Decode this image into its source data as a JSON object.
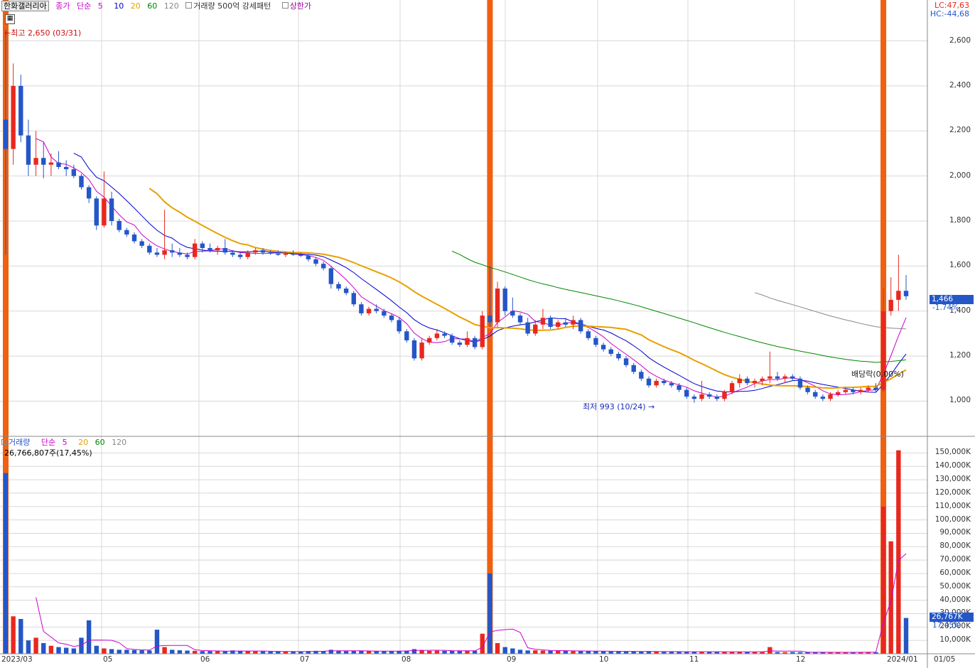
{
  "price_legend": {
    "stock_name": "한화갤러리아",
    "close_label": "종가",
    "ma_type": "단순",
    "ma_periods": [
      "5",
      "10",
      "20",
      "60",
      "120"
    ],
    "ma_colors": [
      "#cc00cc",
      "#0000cc",
      "#e8a000",
      "#008800",
      "#888888"
    ],
    "pattern_label": "거래량 500억 강세패턴",
    "limit_label": "상한가"
  },
  "volume_legend": {
    "title": "거래량",
    "ma_type": "단순",
    "ma_periods": [
      "5",
      "20",
      "60",
      "120"
    ],
    "summary": "26,766,807주(17,45%)"
  },
  "corner": {
    "lc": "LC:47,63",
    "hc": "HC:-44,68"
  },
  "annotations": {
    "high": "최고 2,650 (03/31)",
    "low": "최저 993 (10/24)",
    "ex_dividend": "배당락(0.00%)"
  },
  "current": {
    "price": "1,466",
    "change": "-1.74%",
    "volume": "26,767K",
    "volume_pct": "17.45%"
  },
  "price_axis": [
    "2,600",
    "2,400",
    "2,200",
    "2,000",
    "1,800",
    "1,600",
    "1,400",
    "1,200",
    "1,000"
  ],
  "volume_axis": [
    "150,000K",
    "140,000K",
    "130,000K",
    "120,000K",
    "110,000K",
    "100,000K",
    "90,000K",
    "80,000K",
    "70,000K",
    "60,000K",
    "50,000K",
    "40,000K",
    "30,000K",
    "20,000K",
    "10,000K"
  ],
  "x_labels": [
    "2023/03",
    "05",
    "06",
    "07",
    "08",
    "09",
    "10",
    "11",
    "12",
    "2024/01",
    "01/05"
  ],
  "colors": {
    "up": "#e8281e",
    "down": "#2456c8",
    "signal": "#f06010",
    "grid": "#d8d8d8"
  },
  "chart_data": {
    "type": "candlestick",
    "price_ylim": [
      850,
      2750
    ],
    "volume_ylim": [
      0,
      155000
    ],
    "candles": [
      [
        2250,
        2650,
        1650,
        2120
      ],
      [
        2120,
        2500,
        2050,
        2400
      ],
      [
        2400,
        2450,
        2150,
        2180
      ],
      [
        2180,
        2250,
        2000,
        2050
      ],
      [
        2050,
        2200,
        2000,
        2080
      ],
      [
        2080,
        2150,
        1990,
        2050
      ],
      [
        2050,
        2100,
        2000,
        2060
      ],
      [
        2060,
        2110,
        2030,
        2040
      ],
      [
        2040,
        2070,
        2000,
        2030
      ],
      [
        2030,
        2050,
        1990,
        2000
      ],
      [
        2000,
        2010,
        1940,
        1950
      ],
      [
        1950,
        1960,
        1880,
        1900
      ],
      [
        1900,
        1910,
        1760,
        1780
      ],
      [
        1780,
        2020,
        1770,
        1900
      ],
      [
        1900,
        1930,
        1780,
        1800
      ],
      [
        1800,
        1810,
        1750,
        1760
      ],
      [
        1760,
        1770,
        1730,
        1740
      ],
      [
        1740,
        1750,
        1700,
        1710
      ],
      [
        1710,
        1720,
        1680,
        1690
      ],
      [
        1690,
        1700,
        1650,
        1660
      ],
      [
        1660,
        1680,
        1640,
        1650
      ],
      [
        1650,
        1850,
        1630,
        1670
      ],
      [
        1670,
        1700,
        1640,
        1660
      ],
      [
        1660,
        1680,
        1640,
        1650
      ],
      [
        1650,
        1660,
        1630,
        1640
      ],
      [
        1640,
        1720,
        1630,
        1700
      ],
      [
        1700,
        1710,
        1660,
        1680
      ],
      [
        1680,
        1700,
        1660,
        1670
      ],
      [
        1670,
        1690,
        1650,
        1680
      ],
      [
        1680,
        1720,
        1650,
        1660
      ],
      [
        1660,
        1670,
        1640,
        1650
      ],
      [
        1650,
        1660,
        1630,
        1640
      ],
      [
        1640,
        1670,
        1630,
        1660
      ],
      [
        1660,
        1680,
        1650,
        1670
      ],
      [
        1670,
        1680,
        1650,
        1660
      ],
      [
        1660,
        1670,
        1650,
        1655
      ],
      [
        1655,
        1670,
        1645,
        1650
      ],
      [
        1650,
        1665,
        1640,
        1655
      ],
      [
        1655,
        1670,
        1645,
        1650
      ],
      [
        1650,
        1660,
        1640,
        1645
      ],
      [
        1645,
        1655,
        1620,
        1630
      ],
      [
        1630,
        1640,
        1600,
        1610
      ],
      [
        1610,
        1620,
        1580,
        1590
      ],
      [
        1590,
        1600,
        1500,
        1520
      ],
      [
        1520,
        1530,
        1490,
        1500
      ],
      [
        1500,
        1510,
        1470,
        1480
      ],
      [
        1480,
        1490,
        1420,
        1430
      ],
      [
        1430,
        1440,
        1380,
        1390
      ],
      [
        1390,
        1420,
        1380,
        1410
      ],
      [
        1410,
        1430,
        1390,
        1400
      ],
      [
        1400,
        1410,
        1370,
        1380
      ],
      [
        1380,
        1390,
        1350,
        1360
      ],
      [
        1360,
        1370,
        1300,
        1310
      ],
      [
        1310,
        1320,
        1260,
        1270
      ],
      [
        1270,
        1280,
        1180,
        1190
      ],
      [
        1190,
        1280,
        1180,
        1260
      ],
      [
        1260,
        1290,
        1250,
        1280
      ],
      [
        1280,
        1320,
        1270,
        1300
      ],
      [
        1300,
        1310,
        1280,
        1290
      ],
      [
        1290,
        1300,
        1250,
        1260
      ],
      [
        1260,
        1270,
        1240,
        1250
      ],
      [
        1250,
        1310,
        1240,
        1280
      ],
      [
        1280,
        1290,
        1230,
        1240
      ],
      [
        1240,
        1400,
        1230,
        1380
      ],
      [
        1380,
        1600,
        1330,
        1350
      ],
      [
        1350,
        1530,
        1330,
        1500
      ],
      [
        1500,
        1510,
        1380,
        1400
      ],
      [
        1400,
        1460,
        1370,
        1380
      ],
      [
        1380,
        1390,
        1340,
        1350
      ],
      [
        1350,
        1370,
        1290,
        1300
      ],
      [
        1300,
        1360,
        1290,
        1340
      ],
      [
        1340,
        1410,
        1320,
        1370
      ],
      [
        1370,
        1380,
        1320,
        1330
      ],
      [
        1330,
        1360,
        1320,
        1350
      ],
      [
        1350,
        1370,
        1330,
        1340
      ],
      [
        1340,
        1380,
        1320,
        1360
      ],
      [
        1360,
        1370,
        1300,
        1310
      ],
      [
        1310,
        1320,
        1270,
        1280
      ],
      [
        1280,
        1290,
        1240,
        1250
      ],
      [
        1250,
        1260,
        1220,
        1230
      ],
      [
        1230,
        1240,
        1200,
        1210
      ],
      [
        1210,
        1220,
        1180,
        1190
      ],
      [
        1190,
        1200,
        1150,
        1160
      ],
      [
        1160,
        1170,
        1120,
        1130
      ],
      [
        1130,
        1140,
        1090,
        1100
      ],
      [
        1100,
        1110,
        1060,
        1070
      ],
      [
        1070,
        1100,
        1060,
        1090
      ],
      [
        1090,
        1100,
        1070,
        1080
      ],
      [
        1080,
        1090,
        1060,
        1070
      ],
      [
        1070,
        1080,
        1040,
        1050
      ],
      [
        1050,
        1060,
        1010,
        1020
      ],
      [
        1020,
        1030,
        993,
        1010
      ],
      [
        1010,
        1090,
        1000,
        1030
      ],
      [
        1030,
        1040,
        1010,
        1020
      ],
      [
        1020,
        1030,
        1000,
        1010
      ],
      [
        1010,
        1050,
        1000,
        1040
      ],
      [
        1040,
        1090,
        1030,
        1080
      ],
      [
        1080,
        1120,
        1060,
        1100
      ],
      [
        1100,
        1110,
        1070,
        1080
      ],
      [
        1080,
        1100,
        1060,
        1090
      ],
      [
        1090,
        1110,
        1070,
        1100
      ],
      [
        1100,
        1220,
        1080,
        1110
      ],
      [
        1110,
        1130,
        1090,
        1100
      ],
      [
        1100,
        1120,
        1080,
        1110
      ],
      [
        1110,
        1120,
        1090,
        1100
      ],
      [
        1100,
        1110,
        1050,
        1060
      ],
      [
        1060,
        1070,
        1030,
        1040
      ],
      [
        1040,
        1050,
        1010,
        1020
      ],
      [
        1020,
        1030,
        1000,
        1010
      ],
      [
        1010,
        1040,
        1000,
        1030
      ],
      [
        1030,
        1050,
        1020,
        1040
      ],
      [
        1040,
        1060,
        1030,
        1050
      ],
      [
        1050,
        1060,
        1030,
        1040
      ],
      [
        1040,
        1060,
        1030,
        1050
      ],
      [
        1050,
        1070,
        1040,
        1060
      ],
      [
        1060,
        1080,
        1040,
        1050
      ],
      [
        1050,
        1500,
        1040,
        1400
      ],
      [
        1400,
        1550,
        1380,
        1450
      ],
      [
        1450,
        1650,
        1400,
        1490
      ],
      [
        1490,
        1560,
        1450,
        1466
      ]
    ],
    "volume": [
      135000,
      28000,
      26000,
      10000,
      12000,
      8000,
      6000,
      5000,
      4500,
      4000,
      12000,
      25000,
      6000,
      4000,
      3500,
      3000,
      3000,
      2800,
      2600,
      2500,
      18000,
      5000,
      3000,
      2600,
      2400,
      2200,
      2000,
      2000,
      1900,
      1800,
      2500,
      2200,
      2000,
      1800,
      1800,
      1700,
      1600,
      1700,
      1600,
      1600,
      2000,
      2200,
      2100,
      3000,
      2200,
      2000,
      2100,
      2200,
      2000,
      1900,
      2000,
      2100,
      2200,
      2400,
      3500,
      2800,
      2200,
      2300,
      2200,
      2300,
      2100,
      2200,
      2300,
      15000,
      60000,
      8000,
      5000,
      4000,
      3000,
      2500,
      2600,
      2400,
      2300,
      2200,
      2100,
      2000,
      2100,
      2000,
      1900,
      1800,
      1700,
      1800,
      1900,
      1700,
      1700,
      1800,
      1600,
      1500,
      1500,
      1500,
      1600,
      1500,
      1600,
      1500,
      1400,
      1400,
      1500,
      1600,
      1400,
      1300,
      1400,
      5000,
      1300,
      1200,
      1300,
      1200,
      1200,
      1100,
      1100,
      1000,
      1100,
      1200,
      1100,
      1200,
      1300,
      1200,
      110000,
      84000,
      152000,
      26767
    ],
    "signal_candle_indices": [
      0,
      64,
      116
    ],
    "note": "Daily candles Mar 2023 – Jan 2024; values estimated from axes"
  }
}
